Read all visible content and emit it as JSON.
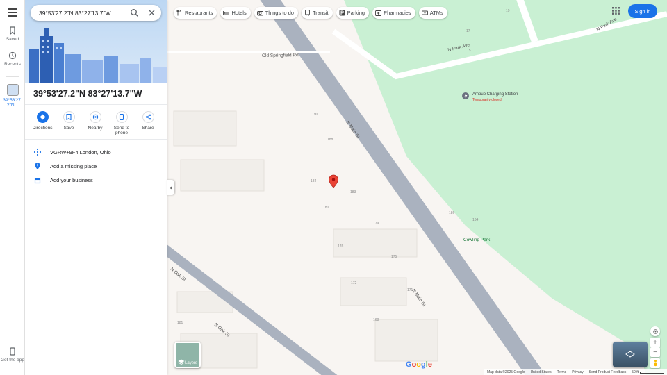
{
  "search": {
    "value": "39°53'27.2\"N 83°27'13.7\"W"
  },
  "rail": {
    "saved_label": "Saved",
    "recents_label": "Recents",
    "current_label": "39°53'27.2\"N...",
    "get_app_label": "Get the app"
  },
  "place": {
    "title": "39°53'27.2\"N 83°27'13.7\"W"
  },
  "actions": [
    {
      "label": "Directions"
    },
    {
      "label": "Save"
    },
    {
      "label": "Nearby"
    },
    {
      "label": "Send to phone"
    },
    {
      "label": "Share"
    }
  ],
  "details": {
    "plus_code": "VGRW+9F4 London, Ohio",
    "add_place": "Add a missing place",
    "add_business": "Add your business"
  },
  "chips": [
    {
      "label": "Restaurants",
      "icon": "fork-knife-icon"
    },
    {
      "label": "Hotels",
      "icon": "bed-icon"
    },
    {
      "label": "Things to do",
      "icon": "camera-icon"
    },
    {
      "label": "Transit",
      "icon": "train-icon"
    },
    {
      "label": "Parking",
      "icon": "parking-icon"
    },
    {
      "label": "Pharmacies",
      "icon": "pharmacy-icon"
    },
    {
      "label": "ATMs",
      "icon": "atm-icon"
    }
  ],
  "header": {
    "sign_in": "Sign in"
  },
  "map": {
    "streets": {
      "n_main_1": "N Main St",
      "n_main_2": "N Main St",
      "n_oak_1": "N Oak St",
      "n_oak_2": "N Oak St",
      "n_park": "N Park Ave",
      "springfield": "Old Springfield Rd"
    },
    "pois": {
      "charging_name": "Ampup Charging Station",
      "charging_status": "Temporarily closed",
      "park_name": "Cowling Park"
    },
    "house_numbers": [
      "19",
      "17",
      "15",
      "190",
      "188",
      "184",
      "183",
      "180",
      "179",
      "176",
      "175",
      "172",
      "171",
      "168",
      "181",
      "186",
      "164"
    ],
    "layers_label": "Layers",
    "colors": {
      "park": "#c9f0d3",
      "road": "#aab2bf",
      "land": "#f8f5f2",
      "accent": "#1a73e8",
      "pin": "#ea4335"
    }
  },
  "footer": {
    "map_data": "Map data ©2025 Google",
    "country": "United States",
    "terms": "Terms",
    "privacy": "Privacy",
    "feedback": "Send Product Feedback",
    "scale": "50 ft"
  }
}
